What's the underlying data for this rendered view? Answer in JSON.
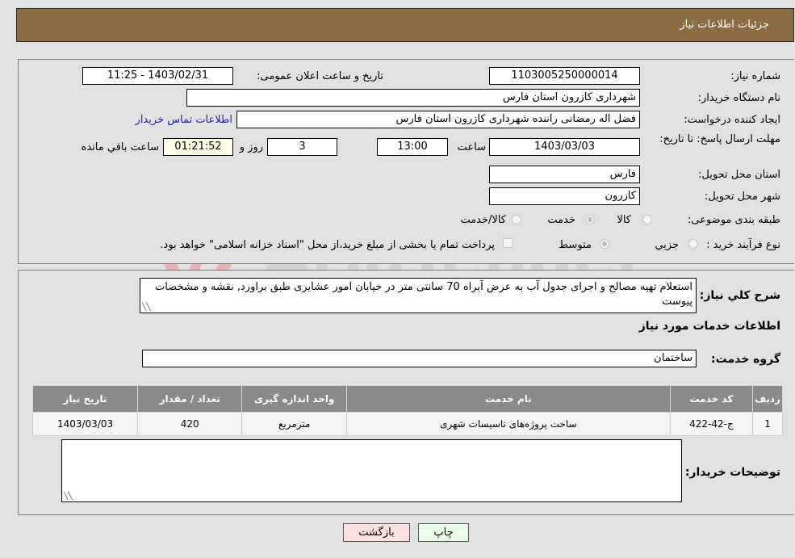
{
  "header": {
    "title": "جزئیات اطلاعات نیاز"
  },
  "form": {
    "need_number": {
      "label": "شماره نیاز:",
      "value": "1103005250000014"
    },
    "announce_datetime": {
      "label": "تاریخ و ساعت اعلان عمومی:",
      "value": "1403/02/31 - 11:25"
    },
    "buyer_org": {
      "label": "نام دستگاه خریدار:",
      "value": "شهرداری کازرون استان فارس"
    },
    "creator": {
      "label": "ایجاد کننده درخواست:",
      "value": "فضل اله رمضانی راننده شهرداری کازرون استان فارس"
    },
    "contact_link": "اطلاعات تماس خریدار",
    "deadline": {
      "label": "مهلت ارسال پاسخ: تا تاریخ:",
      "date": "1403/03/03",
      "time_label": "ساعت",
      "time": "13:00",
      "days": "3",
      "days_label": "روز و",
      "remaining": "01:21:52",
      "remaining_label": "ساعت باقي مانده"
    },
    "province": {
      "label": "استان محل تحویل:",
      "value": "فارس"
    },
    "city": {
      "label": "شهر محل تحویل:",
      "value": "کازرون"
    },
    "category": {
      "label": "طبقه بندی موضوعی:",
      "options": [
        "کالا",
        "خدمت",
        "کالا/خدمت"
      ],
      "selected": "خدمت"
    },
    "process": {
      "label": "نوع فرآیند خرید :",
      "options": [
        "جزيي",
        "متوسط"
      ],
      "selected": "متوسط",
      "treasury_note": "پرداخت تمام یا بخشی از مبلغ خرید،از محل \"اسناد خزانه اسلامی\" خواهد بود.",
      "treasury_checked": false
    }
  },
  "details": {
    "description_label": "شرح كلي نياز:",
    "description": "استعلام تهیه مصالح و اجرای جدول آب به عرض آبراه 70 سانتی متر در خیابان امور عشایری طبق براورد, نقشه و مشخصات پیوست",
    "services_heading": "اطلاعات خدمات مورد نیاز",
    "service_group_label": "گروه خدمت:",
    "service_group": "ساختمان",
    "table": {
      "headers": [
        "ردیف",
        "کد خدمت",
        "نام خدمت",
        "واحد اندازه گیری",
        "تعداد / مقدار",
        "تاریخ نیاز"
      ],
      "rows": [
        [
          "1",
          "ج-42-422",
          "ساخت پروژه‌های تاسیسات شهری",
          "مترمربع",
          "420",
          "1403/03/03"
        ]
      ]
    },
    "buyer_notes_label": "توضیحات خریدار:",
    "buyer_notes": ""
  },
  "buttons": {
    "print": "چاپ",
    "back": "بازگشت"
  },
  "watermark": "AriaTender.neT",
  "colors": {
    "header_bg": "#8c6d43",
    "print_bg": "#eaffea",
    "back_bg": "#ffe0e0",
    "link": "#2020c0"
  }
}
